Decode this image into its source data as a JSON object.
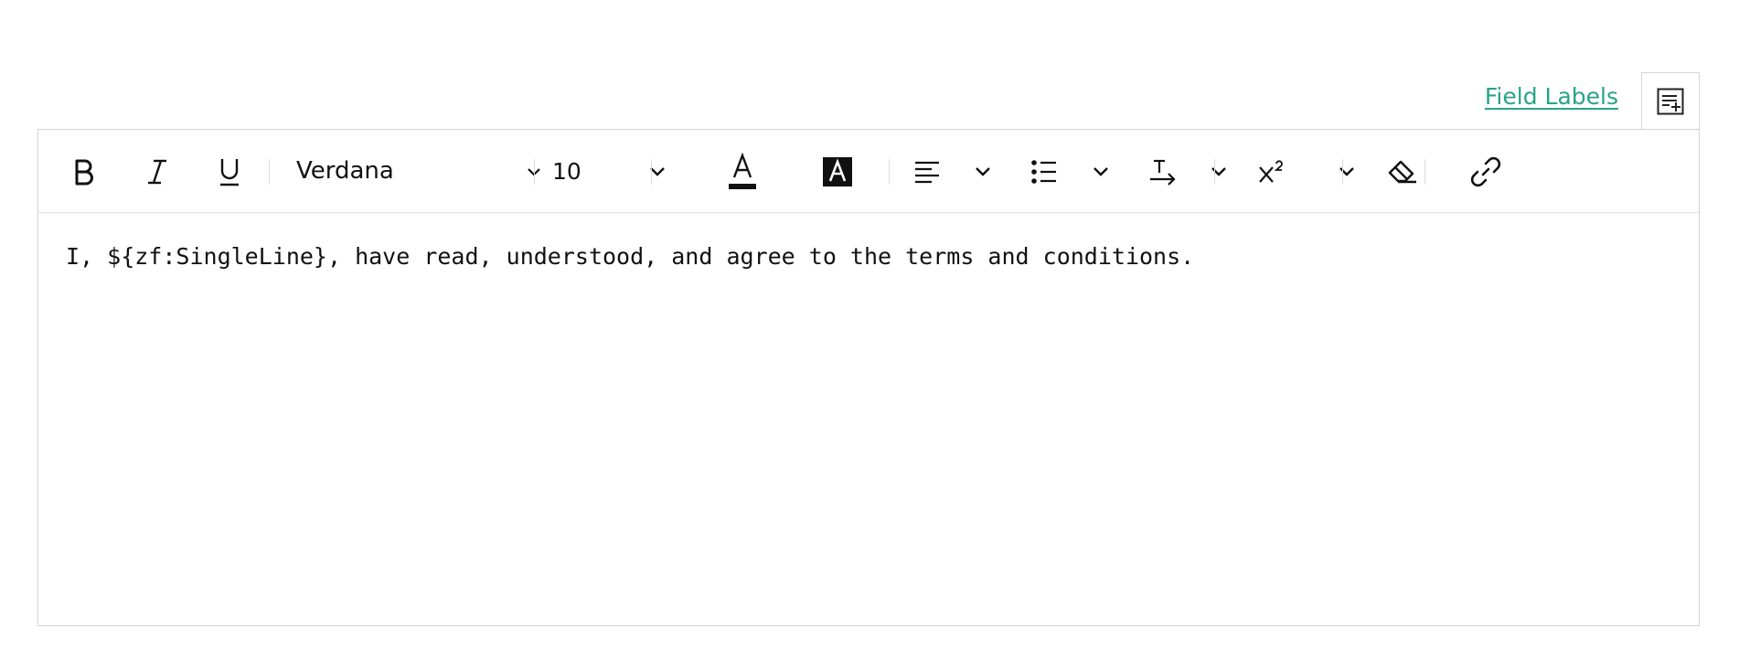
{
  "header": {
    "field_labels_link": "Field Labels",
    "insert_icon": "insert-field-icon"
  },
  "toolbar": {
    "bold_icon": "bold-icon",
    "italic_icon": "italic-icon",
    "underline_icon": "underline-icon",
    "font_family": "Verdana",
    "font_size": "10",
    "text_color_icon": "text-color-icon",
    "highlight_icon": "background-color-icon",
    "align_icon": "align-left-icon",
    "list_icon": "bullet-list-icon",
    "direction_icon": "text-direction-icon",
    "superscript_icon": "superscript-icon",
    "clear_format_icon": "eraser-icon",
    "link_icon": "link-icon",
    "accent_color": "#2aa38a"
  },
  "editor": {
    "content": "I, ${zf:SingleLine}, have read, understood, and agree to the terms and conditions."
  }
}
